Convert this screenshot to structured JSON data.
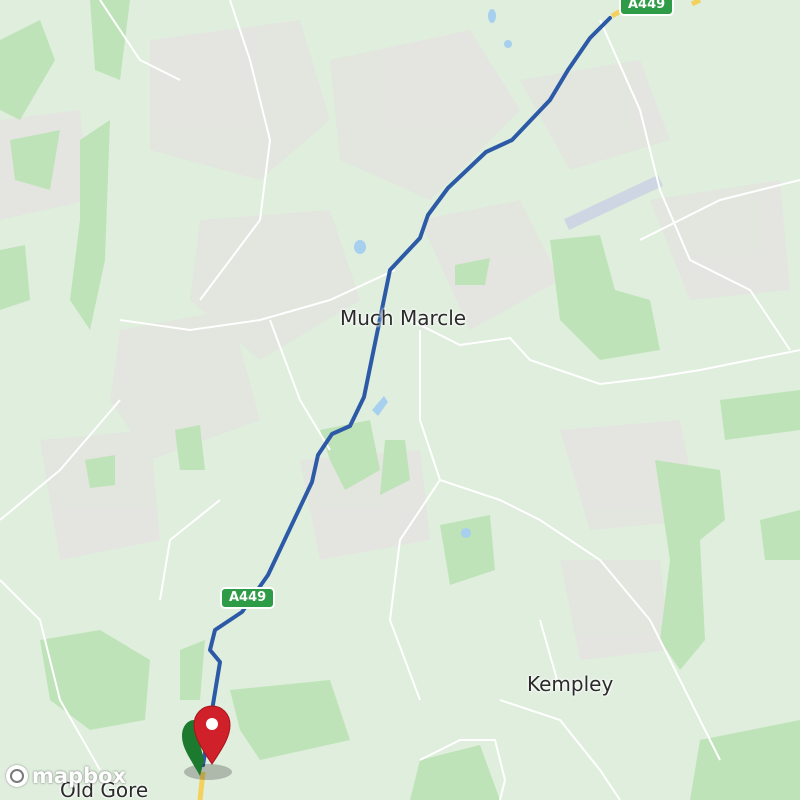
{
  "places": {
    "much_marcle": "Much Marcle",
    "kempley": "Kempley",
    "old_gore": "Old Gore"
  },
  "roads": {
    "a449_north": "A449",
    "a449_south": "A449"
  },
  "attribution": {
    "logo_text": "mapbox"
  },
  "markers": {
    "start_icon": "green-origin-marker",
    "end_icon": "red-destination-pin"
  },
  "colors": {
    "land": "#dfeedd",
    "forest": "#bfe3b8",
    "settlement": "#e6e1e1",
    "road": "#ffffff",
    "route": "#2d5aa6",
    "water": "#a7cfee",
    "major_road": "#f4d15c",
    "shield": "#2e9b46",
    "pin": "#d0212b"
  }
}
